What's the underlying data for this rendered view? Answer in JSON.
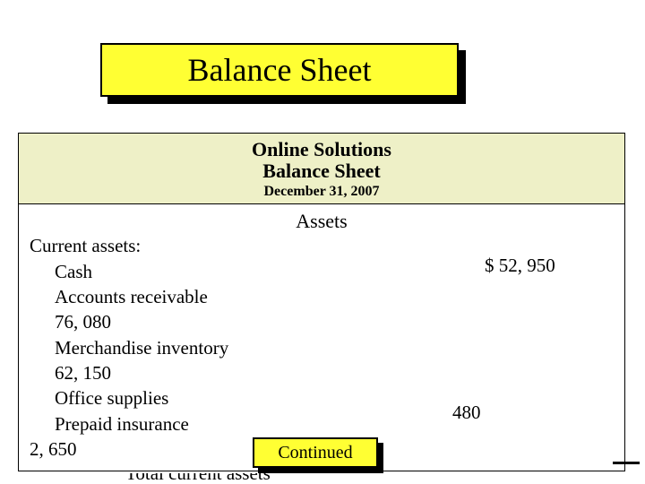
{
  "title": "Balance Sheet",
  "header": {
    "company": "Online Solutions",
    "doc": "Balance Sheet",
    "date": "December 31, 2007"
  },
  "section": "Assets",
  "lines": {
    "current_assets": "Current assets:",
    "cash": "Cash",
    "ar": "Accounts receivable",
    "ar_val": "76, 080",
    "inv": "Merchandise inventory",
    "inv_val": "62, 150",
    "supplies": "Office supplies",
    "prepaid": "Prepaid insurance",
    "prepaid_val": "2, 650",
    "total": "Total current assets"
  },
  "amounts": {
    "cash": "$  52, 950",
    "supplies": "480"
  },
  "continued": "Continued"
}
